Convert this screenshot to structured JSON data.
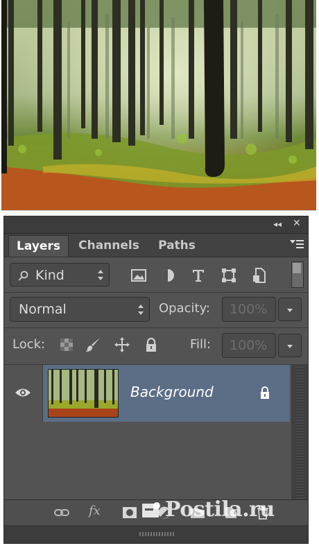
{
  "panel": {
    "tabs": [
      {
        "label": "Layers",
        "active": true
      },
      {
        "label": "Channels",
        "active": false
      },
      {
        "label": "Paths",
        "active": false
      }
    ],
    "titlebar": {
      "collapse_icon": "double-chevron-left-icon",
      "close_icon": "close-icon"
    },
    "filter": {
      "search_icon": "search-icon",
      "kind_label": "Kind",
      "filter_icons": [
        "image-filter-icon",
        "adjustment-filter-icon",
        "type-filter-icon",
        "shape-filter-icon",
        "smart-object-filter-icon"
      ]
    },
    "blend": {
      "mode": "Normal",
      "opacity_label": "Opacity:",
      "opacity_value": "100%"
    },
    "lock": {
      "label": "Lock:",
      "icons": [
        "lock-transparent-icon",
        "lock-image-icon",
        "lock-position-icon",
        "lock-all-icon"
      ],
      "fill_label": "Fill:",
      "fill_value": "100%"
    },
    "layers": [
      {
        "name": "Background",
        "visible": true,
        "locked": true,
        "selected": true
      }
    ],
    "footer_icons": [
      "link-icon",
      "fx-icon",
      "mask-icon",
      "adjustment-icon",
      "folder-icon",
      "new-layer-icon",
      "trash-icon"
    ]
  },
  "watermark": {
    "text": "Postila.ru"
  },
  "colors": {
    "panel_bg": "#535353",
    "selected_layer": "#5b6e85",
    "text": "#dcdcdc"
  }
}
